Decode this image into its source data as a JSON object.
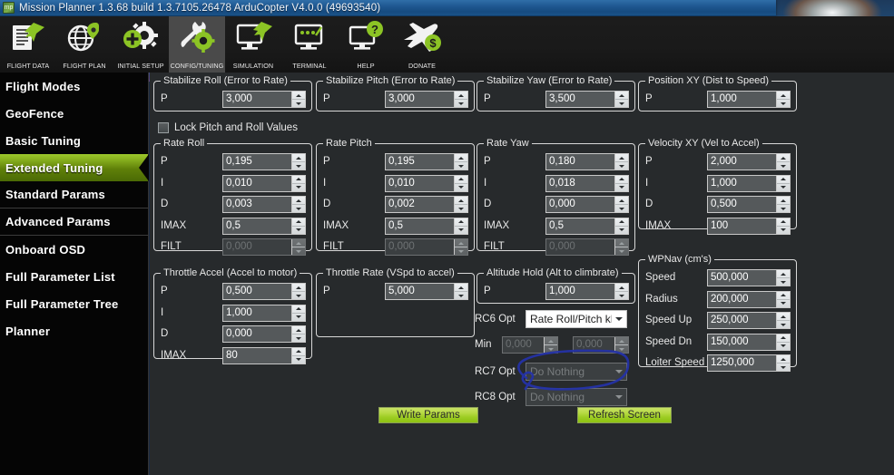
{
  "window": {
    "title": "Mission Planner 1.3.68 build 1.3.7105.26478 ArduCopter V4.0.0 (49693540)",
    "icon": "mp"
  },
  "toolbar": {
    "items": [
      {
        "label": "FLIGHT DATA",
        "icon": "flight-data-icon",
        "selected": false
      },
      {
        "label": "FLIGHT PLAN",
        "icon": "flight-plan-icon",
        "selected": false
      },
      {
        "label": "INITIAL SETUP",
        "icon": "initial-setup-icon",
        "selected": false
      },
      {
        "label": "CONFIG/TUNING",
        "icon": "config-tuning-icon",
        "selected": true
      },
      {
        "label": "SIMULATION",
        "icon": "simulation-icon",
        "selected": false
      },
      {
        "label": "TERMINAL",
        "icon": "terminal-icon",
        "selected": false
      },
      {
        "label": "HELP",
        "icon": "help-icon",
        "selected": false
      },
      {
        "label": "DONATE",
        "icon": "donate-icon",
        "selected": false
      }
    ]
  },
  "sidebar": {
    "items": [
      {
        "label": "Flight Modes",
        "active": false,
        "separator": false
      },
      {
        "label": "GeoFence",
        "active": false,
        "separator": false
      },
      {
        "label": "Basic Tuning",
        "active": false,
        "separator": false
      },
      {
        "label": "Extended Tuning",
        "active": true,
        "separator": false
      },
      {
        "label": "Standard Params",
        "active": false,
        "separator": true
      },
      {
        "label": "Advanced Params",
        "active": false,
        "separator": true
      },
      {
        "label": "Onboard OSD",
        "active": false,
        "separator": false
      },
      {
        "label": "Full Parameter List",
        "active": false,
        "separator": false
      },
      {
        "label": "Full Parameter Tree",
        "active": false,
        "separator": false
      },
      {
        "label": "Planner",
        "active": false,
        "separator": false
      }
    ]
  },
  "main": {
    "lock_checkbox": {
      "label": "Lock Pitch and Roll Values",
      "checked": false
    },
    "groups": {
      "stabilize_roll": {
        "title": "Stabilize Roll (Error to Rate)",
        "rows": [
          {
            "label": "P",
            "value": "3,000",
            "disabled": false
          }
        ]
      },
      "stabilize_pitch": {
        "title": "Stabilize Pitch (Error to Rate)",
        "rows": [
          {
            "label": "P",
            "value": "3,000",
            "disabled": false
          }
        ]
      },
      "stabilize_yaw": {
        "title": "Stabilize Yaw (Error to Rate)",
        "rows": [
          {
            "label": "P",
            "value": "3,500",
            "disabled": false
          }
        ]
      },
      "position_xy": {
        "title": "Position XY (Dist to Speed)",
        "rows": [
          {
            "label": "P",
            "value": "1,000",
            "disabled": false
          }
        ]
      },
      "rate_roll": {
        "title": "Rate Roll",
        "rows": [
          {
            "label": "P",
            "value": "0,195",
            "disabled": false
          },
          {
            "label": "I",
            "value": "0,010",
            "disabled": false
          },
          {
            "label": "D",
            "value": "0,003",
            "disabled": false
          },
          {
            "label": "IMAX",
            "value": "0,5",
            "disabled": false
          },
          {
            "label": "FILT",
            "value": "0,000",
            "disabled": true
          }
        ]
      },
      "rate_pitch": {
        "title": "Rate Pitch",
        "rows": [
          {
            "label": "P",
            "value": "0,195",
            "disabled": false
          },
          {
            "label": "I",
            "value": "0,010",
            "disabled": false
          },
          {
            "label": "D",
            "value": "0,002",
            "disabled": false
          },
          {
            "label": "IMAX",
            "value": "0,5",
            "disabled": false
          },
          {
            "label": "FILT",
            "value": "0,000",
            "disabled": true
          }
        ]
      },
      "rate_yaw": {
        "title": "Rate Yaw",
        "rows": [
          {
            "label": "P",
            "value": "0,180",
            "disabled": false
          },
          {
            "label": "I",
            "value": "0,018",
            "disabled": false
          },
          {
            "label": "D",
            "value": "0,000",
            "disabled": false
          },
          {
            "label": "IMAX",
            "value": "0,5",
            "disabled": false
          },
          {
            "label": "FILT",
            "value": "0,000",
            "disabled": true
          }
        ]
      },
      "velocity_xy": {
        "title": "Velocity XY (Vel to Accel)",
        "rows": [
          {
            "label": "P",
            "value": "2,000",
            "disabled": false
          },
          {
            "label": "I",
            "value": "1,000",
            "disabled": false
          },
          {
            "label": "D",
            "value": "0,500",
            "disabled": false
          },
          {
            "label": "IMAX",
            "value": "100",
            "disabled": false
          }
        ]
      },
      "throttle_accel": {
        "title": "Throttle Accel (Accel to motor)",
        "rows": [
          {
            "label": "P",
            "value": "0,500",
            "disabled": false
          },
          {
            "label": "I",
            "value": "1,000",
            "disabled": false
          },
          {
            "label": "D",
            "value": "0,000",
            "disabled": false
          },
          {
            "label": "IMAX",
            "value": "80",
            "disabled": false
          }
        ]
      },
      "throttle_rate": {
        "title": "Throttle Rate (VSpd to accel)",
        "rows": [
          {
            "label": "P",
            "value": "5,000",
            "disabled": false
          }
        ]
      },
      "altitude_hold": {
        "title": "Altitude Hold (Alt to climbrate)",
        "rows": [
          {
            "label": "P",
            "value": "1,000",
            "disabled": false
          }
        ]
      },
      "wpnav": {
        "title": "WPNav (cm's)",
        "rows": [
          {
            "label": "Speed",
            "value": "500,000",
            "disabled": false
          },
          {
            "label": "Radius",
            "value": "200,000",
            "disabled": false
          },
          {
            "label": "Speed Up",
            "value": "250,000",
            "disabled": false
          },
          {
            "label": "Speed Dn",
            "value": "150,000",
            "disabled": false
          },
          {
            "label": "Loiter Speed",
            "value": "1250,000",
            "disabled": false
          }
        ]
      }
    },
    "rc_options": [
      {
        "label": "RC6 Opt",
        "value": "Rate Roll/Pitch kP",
        "disabled": false,
        "annotated": false
      },
      {
        "label": "RC7 Opt",
        "value": "Do Nothing",
        "disabled": true,
        "annotated": true
      },
      {
        "label": "RC8 Opt",
        "value": "Do Nothing",
        "disabled": true,
        "annotated": false
      }
    ],
    "min_row": {
      "label": "Min",
      "left_value": "0,000",
      "right_value": "0,000",
      "disabled": true
    },
    "buttons": {
      "write_params": "Write Params",
      "refresh_screen": "Refresh Screen"
    }
  },
  "colors": {
    "accent_green": "#9ccc22",
    "panel_bg": "#272a2c",
    "sidebar_bg": "#050505",
    "titlebar_blue": "#1f5891",
    "annotation_blue": "#2a3aa8"
  }
}
